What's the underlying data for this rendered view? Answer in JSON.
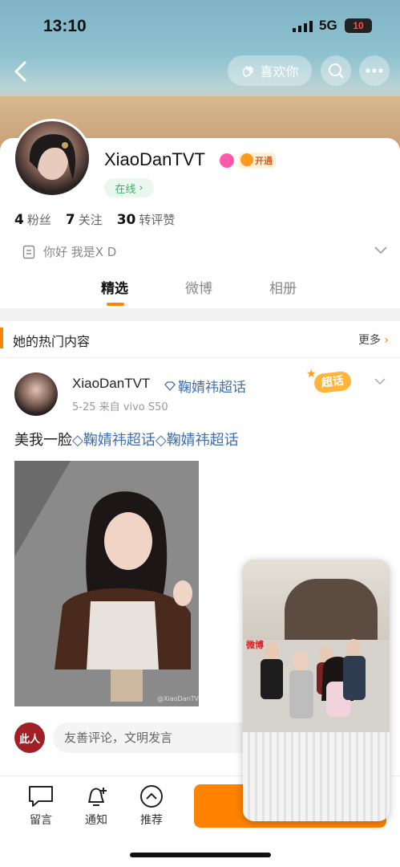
{
  "status": {
    "time": "13:10",
    "network": "5G",
    "battery": "10"
  },
  "header": {
    "like_button": "喜欢你"
  },
  "profile": {
    "name": "XiaoDanTVT",
    "vip_label": "开通",
    "online_label": "在线",
    "stats": [
      {
        "count": "4",
        "label": "粉丝"
      },
      {
        "count": "7",
        "label": "关注"
      },
      {
        "count": "30",
        "label": "转评赞"
      }
    ],
    "bio": "你好 我是X D"
  },
  "tabs": [
    "精选",
    "微博",
    "相册"
  ],
  "section": {
    "title": "她的热门内容",
    "more": "更多"
  },
  "post": {
    "author": "XiaoDanTVT",
    "topic": "鞠婧祎超话",
    "meta": "5-25  来自 vivo S50",
    "badge": "超话",
    "text_prefix": "美我一脸",
    "text_topic1": "鞠婧祎超话",
    "text_topic2": "鞠婧祎超话",
    "watermark": "@XiaoDanTVT"
  },
  "comment": {
    "seal": "此人",
    "placeholder": "友善评论，文明发言"
  },
  "bottom_nav": [
    {
      "label": "留言",
      "icon": "message-icon"
    },
    {
      "label": "通知",
      "icon": "bell-plus-icon"
    },
    {
      "label": "推荐",
      "icon": "chevron-up-circle-icon"
    }
  ],
  "pip": {
    "logo": "微博"
  },
  "colors": {
    "accent": "#ff8200",
    "link": "#3b6fb6",
    "online": "#3bb065"
  }
}
